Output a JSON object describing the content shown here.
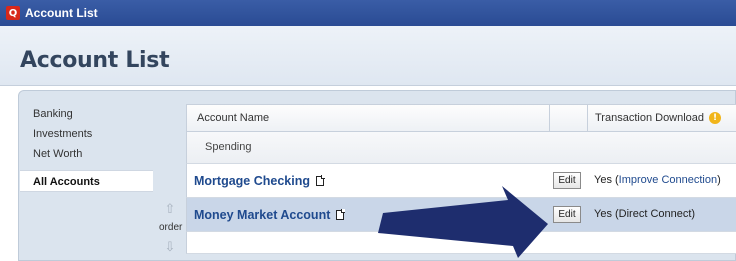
{
  "window": {
    "title": "Account List",
    "icon": "quicken-app-icon"
  },
  "page": {
    "title": "Account List"
  },
  "sidebar": {
    "items": [
      {
        "label": "Banking"
      },
      {
        "label": "Investments"
      },
      {
        "label": "Net Worth"
      },
      {
        "label": "All Accounts",
        "active": true
      }
    ]
  },
  "order_control": {
    "label": "order"
  },
  "table": {
    "columns": [
      "Account Name",
      "",
      "Transaction Download"
    ],
    "group": "Spending",
    "rows": [
      {
        "name": "Mortgage Checking",
        "edit_label": "Edit",
        "status_prefix": "Yes (",
        "status_link": "Improve Connection",
        "status_suffix": ")"
      },
      {
        "name": "Money Market Account",
        "edit_label": "Edit",
        "status": "Yes (Direct Connect)",
        "selected": true
      }
    ]
  },
  "colors": {
    "titlebar": "#2a4b94",
    "link": "#1f4a8e",
    "selected_row": "#c9d6e8",
    "arrow": "#1e2d6e"
  }
}
